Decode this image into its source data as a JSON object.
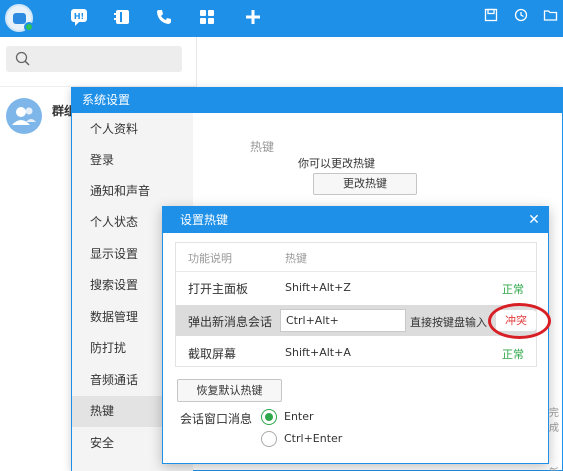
{
  "topbar": {
    "nav_icons": [
      "chat-icon",
      "contacts-book-icon",
      "phone-icon",
      "apps-grid-icon",
      "plus-icon"
    ],
    "right_icons": [
      "save-icon",
      "history-clock-icon",
      "folder-icon"
    ],
    "accent_color": "#1e90e8"
  },
  "left_panel": {
    "search_icon": "search-icon",
    "contact": {
      "name": "群组"
    }
  },
  "settings": {
    "title": "系统设置",
    "nav_items": [
      {
        "label": "个人资料"
      },
      {
        "label": "登录"
      },
      {
        "label": "通知和声音"
      },
      {
        "label": "个人状态"
      },
      {
        "label": "显示设置"
      },
      {
        "label": "搜索设置"
      },
      {
        "label": "数据管理"
      },
      {
        "label": "防打扰"
      },
      {
        "label": "音频通话"
      },
      {
        "label": "热键"
      },
      {
        "label": "安全"
      }
    ],
    "active_item": "热键",
    "hotkey_section_label": "热键",
    "hotkey_desc": "你可以更改热键",
    "change_hotkey_button": "更改热键",
    "stub_text_1": "完成",
    "stub_text_2": "新"
  },
  "dialog": {
    "title": "设置热键",
    "close_icon": "close-icon",
    "table": {
      "headers": [
        "功能说明",
        "热键"
      ],
      "rows": [
        {
          "function": "打开主面板",
          "hotkey": "Shift+Alt+Z",
          "status": "正常"
        },
        {
          "function": "弹出新消息会话",
          "hotkey": "Ctrl+Alt+",
          "hint": "直接按键盘输入",
          "status": "冲突"
        },
        {
          "function": "截取屏幕",
          "hotkey": "Shift+Alt+A",
          "status": "正常"
        }
      ]
    },
    "reset_button": "恢复默认热键",
    "session_window_label": "会话窗口消息",
    "options": [
      {
        "label": "Enter",
        "selected": true
      },
      {
        "label": "Ctrl+Enter",
        "selected": false
      }
    ],
    "status_ok_color": "#2ea84a",
    "status_conflict_color": "#e23b3b"
  }
}
